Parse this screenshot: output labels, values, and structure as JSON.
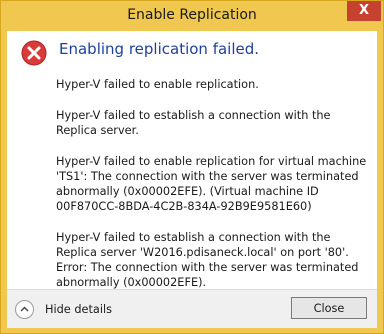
{
  "window": {
    "title": "Enable Replication",
    "close_glyph": "X"
  },
  "icon": "error-icon",
  "colors": {
    "titlebar": "#f0c74f",
    "heading": "#1f3f9e",
    "error_red": "#d93a3a"
  },
  "dialog": {
    "heading": "Enabling replication failed.",
    "messages": [
      "Hyper-V failed to enable replication.",
      "Hyper-V failed to establish a connection with the Replica server.",
      "Hyper-V failed to enable replication for virtual machine 'TS1': The connection with the server was terminated abnormally (0x00002EFE). (Virtual machine ID 00F870CC-8BDA-4C2B-834A-92B9E9581E60)",
      "Hyper-V failed to establish a connection with the Replica server 'W2016.pdisaneck.local' on port '80'. Error: The connection with the server was terminated abnormally (0x00002EFE)."
    ]
  },
  "footer": {
    "details_label": "Hide details",
    "close_label": "Close"
  }
}
